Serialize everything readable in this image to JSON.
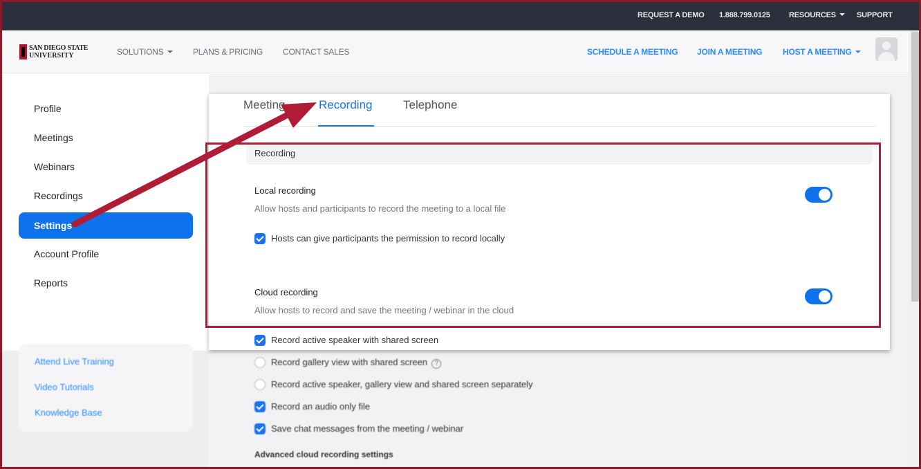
{
  "topbar": {
    "request_demo": "REQUEST A DEMO",
    "phone": "1.888.799.0125",
    "resources": "RESOURCES",
    "support": "SUPPORT"
  },
  "logo": {
    "line1": "SAN DIEGO STATE",
    "line2": "UNIVERSITY"
  },
  "nav": {
    "solutions": "SOLUTIONS",
    "plans": "PLANS & PRICING",
    "contact": "CONTACT SALES",
    "schedule": "SCHEDULE A MEETING",
    "join": "JOIN A MEETING",
    "host": "HOST A MEETING"
  },
  "sidebar": {
    "items": [
      {
        "label": "Profile"
      },
      {
        "label": "Meetings"
      },
      {
        "label": "Webinars"
      },
      {
        "label": "Recordings"
      },
      {
        "label": "Settings"
      },
      {
        "label": "Account Profile"
      },
      {
        "label": "Reports"
      }
    ],
    "active_index": 4,
    "links": [
      {
        "label": "Attend Live Training"
      },
      {
        "label": "Video Tutorials"
      },
      {
        "label": "Knowledge Base"
      }
    ]
  },
  "tabs": [
    {
      "label": "Meeting"
    },
    {
      "label": "Recording"
    },
    {
      "label": "Telephone"
    }
  ],
  "recording": {
    "section_title": "Recording",
    "local": {
      "title": "Local recording",
      "desc": "Allow hosts and participants to record the meeting to a local file",
      "enabled": true,
      "option": {
        "label": "Hosts can give participants the permission to record locally",
        "checked": true
      }
    },
    "cloud": {
      "title": "Cloud recording",
      "desc": "Allow hosts to record and save the meeting / webinar in the cloud",
      "enabled": true,
      "options": [
        {
          "label": "Record active speaker with shared screen",
          "checked": true
        },
        {
          "label": "Record gallery view with shared screen",
          "checked": false,
          "help": "?"
        },
        {
          "label": "Record active speaker, gallery view and shared screen separately",
          "checked": false
        },
        {
          "label": "Record an audio only file",
          "checked": true
        },
        {
          "label": "Save chat messages from the meeting / webinar",
          "checked": true
        }
      ]
    },
    "advanced_title": "Advanced cloud recording settings"
  },
  "colors": {
    "accent": "#0e72ed",
    "annotation": "#b01b35",
    "topbar": "#2b2f3c"
  }
}
